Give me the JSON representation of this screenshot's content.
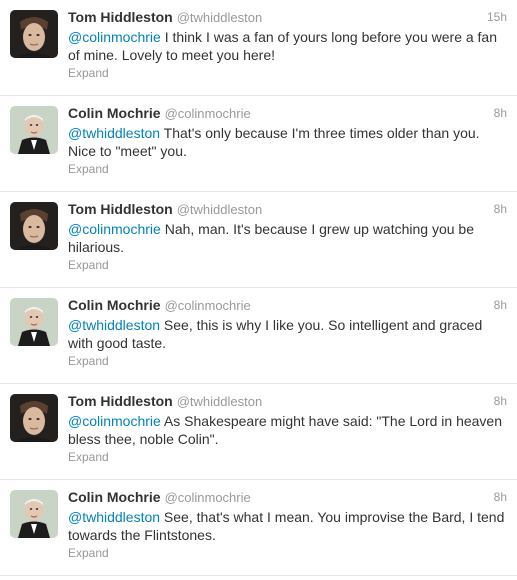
{
  "tweets": [
    {
      "avatar": "tom-hiddleston-avatar",
      "name": "Tom Hiddleston",
      "handle": "@twhiddleston",
      "time": "15h",
      "mention": "@colinmochrie",
      "text": " I think I was a fan of yours long before you were a fan of mine. Lovely to meet you here!",
      "expand": "Expand"
    },
    {
      "avatar": "colin-mochrie-avatar",
      "name": "Colin Mochrie",
      "handle": "@colinmochrie",
      "time": "8h",
      "mention": "@twhiddleston",
      "text": " That's only because I'm three times older than you. Nice to \"meet\" you.",
      "expand": "Expand"
    },
    {
      "avatar": "tom-hiddleston-avatar",
      "name": "Tom Hiddleston",
      "handle": "@twhiddleston",
      "time": "8h",
      "mention": "@colinmochrie",
      "text": " Nah, man. It's because I grew up watching you be hilarious.",
      "expand": "Expand"
    },
    {
      "avatar": "colin-mochrie-avatar",
      "name": "Colin Mochrie",
      "handle": "@colinmochrie",
      "time": "8h",
      "mention": "@twhiddleston",
      "text": " See, this is why I like you. So intelligent and graced with good taste.",
      "expand": "Expand"
    },
    {
      "avatar": "tom-hiddleston-avatar",
      "name": "Tom Hiddleston",
      "handle": "@twhiddleston",
      "time": "8h",
      "mention": "@colinmochrie",
      "text": " As Shakespeare might have said: \"The Lord in heaven bless thee, noble Colin\".",
      "expand": "Expand"
    },
    {
      "avatar": "colin-mochrie-avatar",
      "name": "Colin Mochrie",
      "handle": "@colinmochrie",
      "time": "8h",
      "mention": "@twhiddleston",
      "text": " See, that's what I mean. You improvise the Bard, I tend towards the Flintstones.",
      "expand": "Expand"
    }
  ]
}
